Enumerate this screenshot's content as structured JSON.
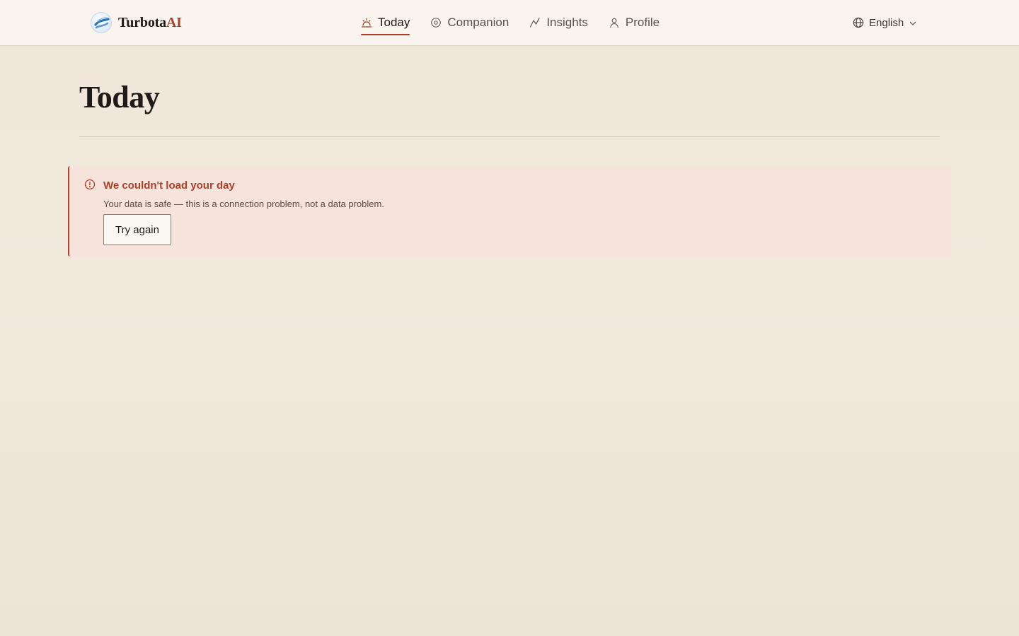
{
  "brand": {
    "name_main": "Turbota",
    "name_accent": "AI",
    "logo_icon": "turbota-logo-icon"
  },
  "nav": {
    "items": [
      {
        "label": "Today",
        "icon": "sunrise-icon",
        "active": true
      },
      {
        "label": "Companion",
        "icon": "companion-icon",
        "active": false
      },
      {
        "label": "Insights",
        "icon": "insights-icon",
        "active": false
      },
      {
        "label": "Profile",
        "icon": "user-icon",
        "active": false
      }
    ]
  },
  "language": {
    "selected": "English",
    "icon": "globe-icon"
  },
  "page": {
    "title": "Today"
  },
  "error": {
    "title": "We couldn't load your day",
    "message": "Your data is safe — this is a connection problem, not a data problem.",
    "retry_label": "Try again",
    "icon": "alert-circle-icon"
  },
  "colors": {
    "accent": "#a8402a",
    "error_bg": "#f6e3dc",
    "header_bg": "#f9f5ee",
    "page_bg": "#f0e8db"
  }
}
